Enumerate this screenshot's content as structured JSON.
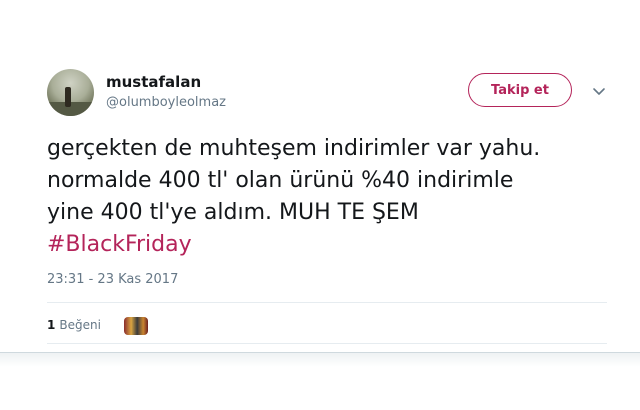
{
  "user": {
    "name": "mustafalan",
    "handle": "@olumboyleolmaz"
  },
  "follow_button": {
    "label": "Takip et"
  },
  "tweet": {
    "lines": [
      "gerçekten de muhteşem indirimler var yahu.",
      "normalde 400 tl' olan ürünü %40 indirimle",
      "yine 400 tl'ye aldım. MUH TE ŞEM"
    ],
    "hashtag": "#BlackFriday",
    "timestamp": "23:31 - 23 Kas 2017"
  },
  "engagement": {
    "like_count": "1",
    "like_label": "Beğeni"
  },
  "colors": {
    "accent": "#b4245a",
    "text": "#14171a",
    "muted": "#657786",
    "divider": "#e6ecf0"
  },
  "icons": {
    "caret": "chevron-down-icon"
  }
}
